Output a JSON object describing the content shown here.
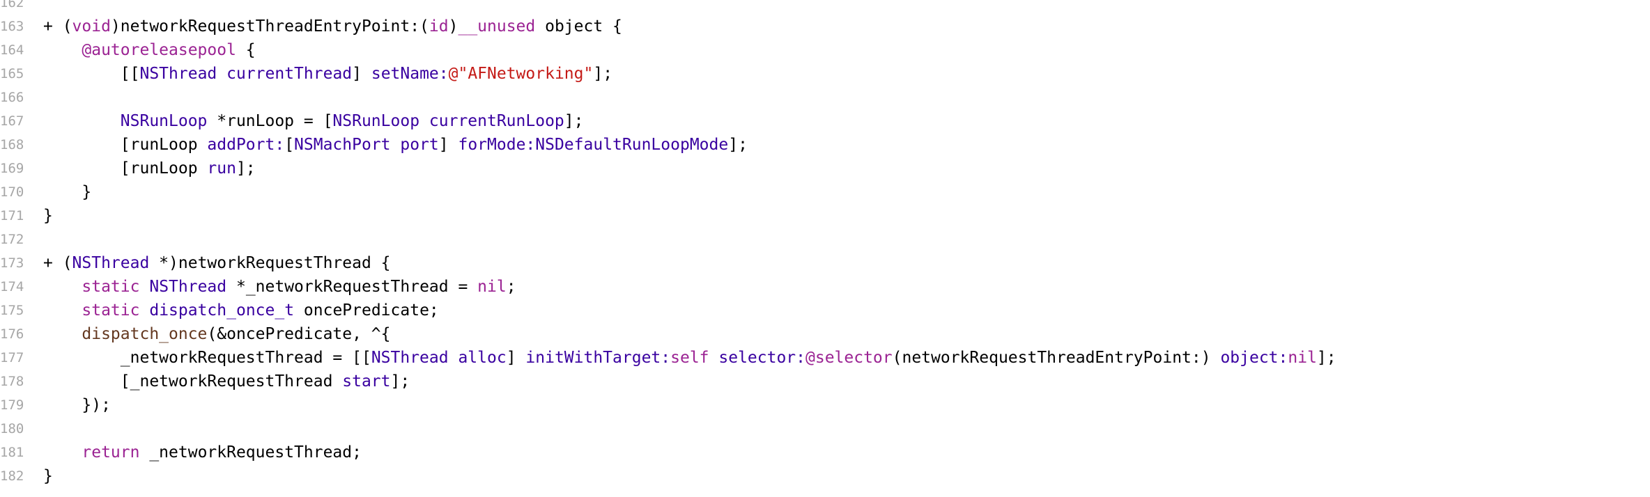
{
  "colors": {
    "background": "#ffffff",
    "gutter_text": "#a6a6a6",
    "plain": "#000000",
    "keyword": "#9b2393",
    "type": "#3900a0",
    "method": "#3900a0",
    "string": "#c41a16",
    "macro": "#643820"
  },
  "editor": {
    "lines": [
      {
        "number": "162",
        "tokens": []
      },
      {
        "number": "163",
        "tokens": [
          {
            "t": "+ (",
            "c": "plain"
          },
          {
            "t": "void",
            "c": "keyword"
          },
          {
            "t": ")networkRequestThreadEntryPoint:(",
            "c": "plain"
          },
          {
            "t": "id",
            "c": "keyword"
          },
          {
            "t": ")",
            "c": "plain"
          },
          {
            "t": "__unused",
            "c": "keyword"
          },
          {
            "t": " object {",
            "c": "plain"
          }
        ]
      },
      {
        "number": "164",
        "tokens": [
          {
            "t": "    ",
            "c": "plain"
          },
          {
            "t": "@autoreleasepool",
            "c": "keyword"
          },
          {
            "t": " {",
            "c": "plain"
          }
        ]
      },
      {
        "number": "165",
        "tokens": [
          {
            "t": "        [[",
            "c": "plain"
          },
          {
            "t": "NSThread",
            "c": "type"
          },
          {
            "t": " ",
            "c": "plain"
          },
          {
            "t": "currentThread",
            "c": "method"
          },
          {
            "t": "] ",
            "c": "plain"
          },
          {
            "t": "setName:",
            "c": "method"
          },
          {
            "t": "@\"AFNetworking\"",
            "c": "string"
          },
          {
            "t": "];",
            "c": "plain"
          }
        ]
      },
      {
        "number": "166",
        "tokens": []
      },
      {
        "number": "167",
        "tokens": [
          {
            "t": "        ",
            "c": "plain"
          },
          {
            "t": "NSRunLoop",
            "c": "type"
          },
          {
            "t": " *runLoop = [",
            "c": "plain"
          },
          {
            "t": "NSRunLoop",
            "c": "type"
          },
          {
            "t": " ",
            "c": "plain"
          },
          {
            "t": "currentRunLoop",
            "c": "method"
          },
          {
            "t": "];",
            "c": "plain"
          }
        ]
      },
      {
        "number": "168",
        "tokens": [
          {
            "t": "        [runLoop ",
            "c": "plain"
          },
          {
            "t": "addPort:",
            "c": "method"
          },
          {
            "t": "[",
            "c": "plain"
          },
          {
            "t": "NSMachPort",
            "c": "type"
          },
          {
            "t": " ",
            "c": "plain"
          },
          {
            "t": "port",
            "c": "method"
          },
          {
            "t": "] ",
            "c": "plain"
          },
          {
            "t": "forMode:",
            "c": "method"
          },
          {
            "t": "NSDefaultRunLoopMode",
            "c": "type"
          },
          {
            "t": "];",
            "c": "plain"
          }
        ]
      },
      {
        "number": "169",
        "tokens": [
          {
            "t": "        [runLoop ",
            "c": "plain"
          },
          {
            "t": "run",
            "c": "method"
          },
          {
            "t": "];",
            "c": "plain"
          }
        ]
      },
      {
        "number": "170",
        "tokens": [
          {
            "t": "    }",
            "c": "plain"
          }
        ]
      },
      {
        "number": "171",
        "tokens": [
          {
            "t": "}",
            "c": "plain"
          }
        ]
      },
      {
        "number": "172",
        "tokens": []
      },
      {
        "number": "173",
        "tokens": [
          {
            "t": "+ (",
            "c": "plain"
          },
          {
            "t": "NSThread",
            "c": "type"
          },
          {
            "t": " *)networkRequestThread {",
            "c": "plain"
          }
        ]
      },
      {
        "number": "174",
        "tokens": [
          {
            "t": "    ",
            "c": "plain"
          },
          {
            "t": "static",
            "c": "keyword"
          },
          {
            "t": " ",
            "c": "plain"
          },
          {
            "t": "NSThread",
            "c": "type"
          },
          {
            "t": " *_networkRequestThread = ",
            "c": "plain"
          },
          {
            "t": "nil",
            "c": "keyword"
          },
          {
            "t": ";",
            "c": "plain"
          }
        ]
      },
      {
        "number": "175",
        "tokens": [
          {
            "t": "    ",
            "c": "plain"
          },
          {
            "t": "static",
            "c": "keyword"
          },
          {
            "t": " ",
            "c": "plain"
          },
          {
            "t": "dispatch_once_t",
            "c": "type"
          },
          {
            "t": " oncePredicate;",
            "c": "plain"
          }
        ]
      },
      {
        "number": "176",
        "tokens": [
          {
            "t": "    ",
            "c": "plain"
          },
          {
            "t": "dispatch_once",
            "c": "macro"
          },
          {
            "t": "(&oncePredicate, ^{",
            "c": "plain"
          }
        ]
      },
      {
        "number": "177",
        "tokens": [
          {
            "t": "        _networkRequestThread = [[",
            "c": "plain"
          },
          {
            "t": "NSThread",
            "c": "type"
          },
          {
            "t": " ",
            "c": "plain"
          },
          {
            "t": "alloc",
            "c": "method"
          },
          {
            "t": "] ",
            "c": "plain"
          },
          {
            "t": "initWithTarget:",
            "c": "method"
          },
          {
            "t": "self",
            "c": "keyword"
          },
          {
            "t": " ",
            "c": "plain"
          },
          {
            "t": "selector:",
            "c": "method"
          },
          {
            "t": "@selector",
            "c": "keyword"
          },
          {
            "t": "(networkRequestThreadEntryPoint:) ",
            "c": "plain"
          },
          {
            "t": "object:",
            "c": "method"
          },
          {
            "t": "nil",
            "c": "keyword"
          },
          {
            "t": "];",
            "c": "plain"
          }
        ]
      },
      {
        "number": "178",
        "tokens": [
          {
            "t": "        [_networkRequestThread ",
            "c": "plain"
          },
          {
            "t": "start",
            "c": "method"
          },
          {
            "t": "];",
            "c": "plain"
          }
        ]
      },
      {
        "number": "179",
        "tokens": [
          {
            "t": "    });",
            "c": "plain"
          }
        ]
      },
      {
        "number": "180",
        "tokens": []
      },
      {
        "number": "181",
        "tokens": [
          {
            "t": "    ",
            "c": "plain"
          },
          {
            "t": "return",
            "c": "keyword"
          },
          {
            "t": " _networkRequestThread;",
            "c": "plain"
          }
        ]
      },
      {
        "number": "182",
        "tokens": [
          {
            "t": "}",
            "c": "plain"
          }
        ]
      }
    ]
  }
}
